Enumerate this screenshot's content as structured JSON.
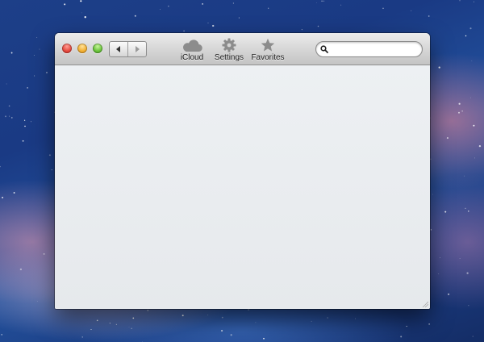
{
  "window": {
    "controls": {
      "close": "close-button",
      "minimize": "minimize-button",
      "zoom": "zoom-button"
    },
    "nav": {
      "back_icon": "chevron-left-icon",
      "forward_icon": "chevron-right-icon"
    },
    "toolbar": {
      "items": [
        {
          "label": "iCloud",
          "icon": "cloud-icon"
        },
        {
          "label": "Settings",
          "icon": "gear-icon"
        },
        {
          "label": "Favorites",
          "icon": "star-icon"
        }
      ]
    },
    "search": {
      "value": "",
      "icon": "search-icon"
    }
  },
  "colors": {
    "close": "#e64a3f",
    "minimize": "#f2b033",
    "zoom": "#6ac43b",
    "content_bg": "#e9ecef",
    "toolbar_icon": "#8c8c8c"
  }
}
